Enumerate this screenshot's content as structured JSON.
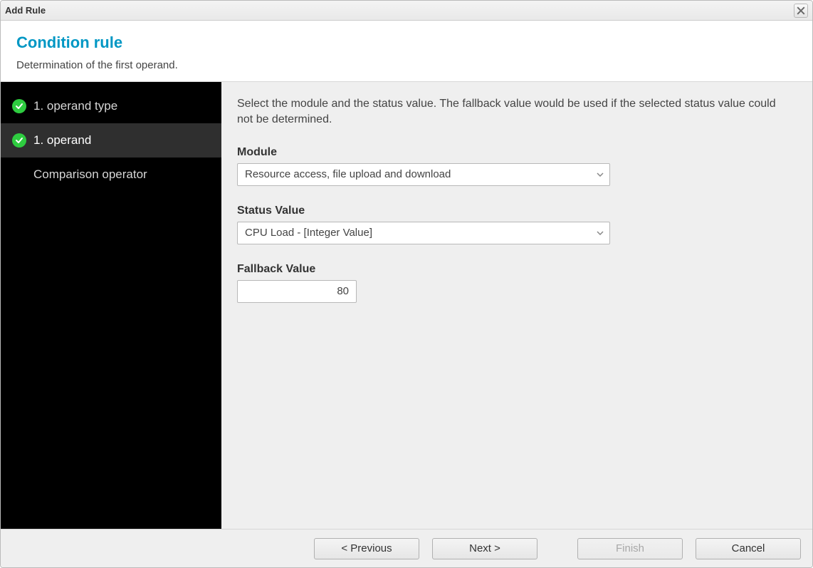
{
  "window": {
    "title": "Add Rule"
  },
  "header": {
    "title": "Condition rule",
    "subtitle": "Determination of the first operand."
  },
  "sidebar": {
    "steps": [
      {
        "label": "1. operand type",
        "done": true,
        "active": false
      },
      {
        "label": "1. operand",
        "done": true,
        "active": true
      },
      {
        "label": "Comparison operator",
        "done": false,
        "active": false
      }
    ]
  },
  "content": {
    "intro": "Select the module and the status value. The fallback value would be used if the selected status value could not be determined.",
    "module_label": "Module",
    "module_value": "Resource access, file upload and download",
    "status_label": "Status Value",
    "status_value": "CPU Load - [Integer Value]",
    "fallback_label": "Fallback Value",
    "fallback_value": "80"
  },
  "footer": {
    "previous": "< Previous",
    "next": "Next >",
    "finish": "Finish",
    "cancel": "Cancel"
  }
}
